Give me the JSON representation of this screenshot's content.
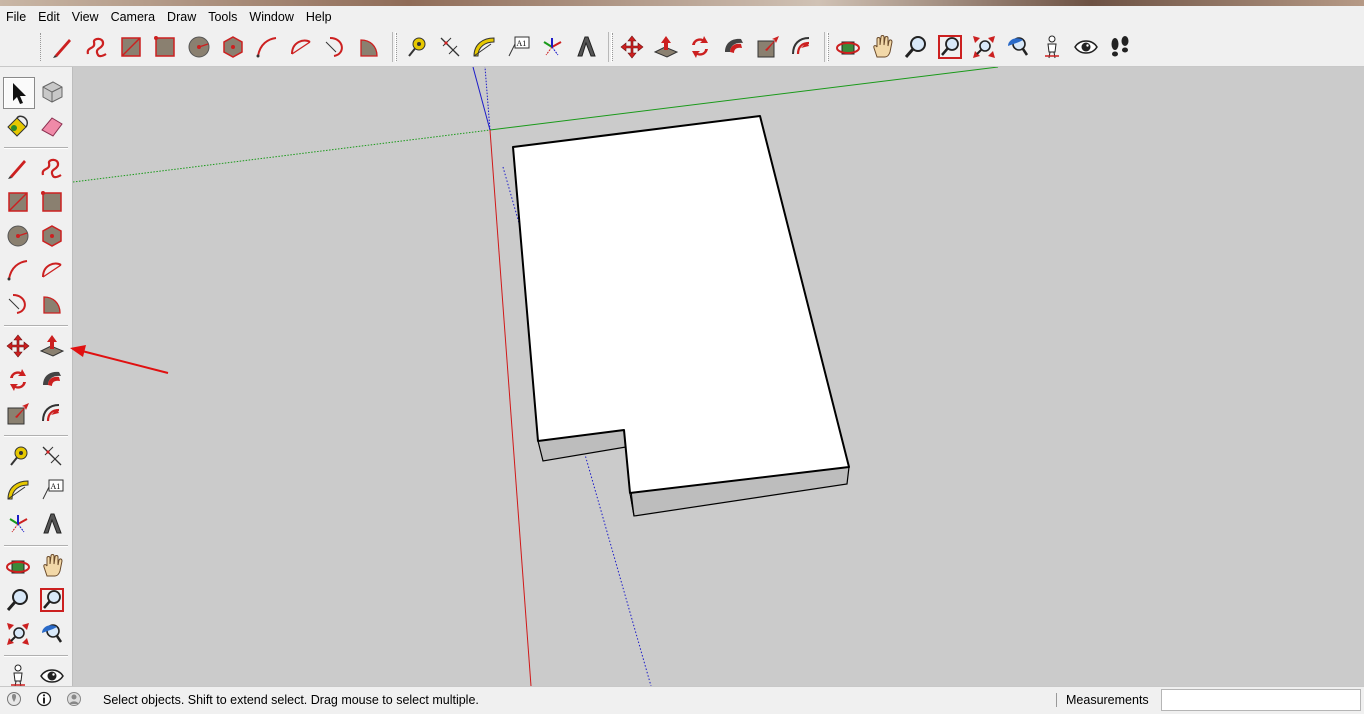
{
  "menu": [
    "File",
    "Edit",
    "View",
    "Camera",
    "Draw",
    "Tools",
    "Window",
    "Help"
  ],
  "top_toolbar": {
    "draw": [
      "line-pencil-icon",
      "freehand-icon",
      "rectangle-icon",
      "rotated-rectangle-icon",
      "circle-icon",
      "polygon-icon",
      "arc-icon",
      "two-point-arc-icon",
      "three-point-arc-icon",
      "pie-icon"
    ],
    "construct": [
      "tape-measure-icon",
      "dimension-icon",
      "protractor-icon",
      "text-icon",
      "axes-icon",
      "3d-text-icon"
    ],
    "edit": [
      "move-icon",
      "push-pull-icon",
      "rotate-icon",
      "follow-me-icon",
      "scale-icon",
      "offset-icon"
    ],
    "camera": [
      "orbit-icon",
      "pan-icon",
      "zoom-icon",
      "zoom-window-icon",
      "zoom-extents-icon",
      "previous-view-icon",
      "position-camera-icon",
      "look-around-icon",
      "walk-icon"
    ],
    "text_tool_label": "A1"
  },
  "left_toolbar": {
    "tools": [
      "select-icon",
      "make-component-icon",
      "paint-bucket-icon",
      "eraser-icon",
      "line-pencil-icon",
      "freehand-icon",
      "rectangle-icon",
      "rotated-rectangle-icon",
      "circle-icon",
      "polygon-icon",
      "arc-icon",
      "two-point-arc-icon",
      "three-point-arc-icon",
      "pie-icon",
      "move-icon",
      "push-pull-icon",
      "rotate-icon",
      "follow-me-icon",
      "scale-icon",
      "offset-icon",
      "tape-measure-icon",
      "dimension-icon",
      "protractor-icon",
      "text-icon",
      "axes-icon",
      "3d-text-icon",
      "orbit-icon",
      "pan-icon",
      "zoom-icon",
      "zoom-window-icon",
      "zoom-extents-icon",
      "previous-view-icon",
      "position-camera-icon",
      "look-around-icon"
    ],
    "active_tool": "select-icon",
    "annotated_tool": "push-pull-icon",
    "text_tool_label": "A1"
  },
  "status": {
    "message": "Select objects. Shift to extend select. Drag mouse to select multiple.",
    "measurements_label": "Measurements",
    "measurements_value": ""
  },
  "colors": {
    "viewport_bg": "#cbcbcb",
    "axis_red": "#d01818",
    "axis_green": "#1a9a1a",
    "axis_blue": "#1c1cc8",
    "annotation_arrow": "#e01010"
  }
}
